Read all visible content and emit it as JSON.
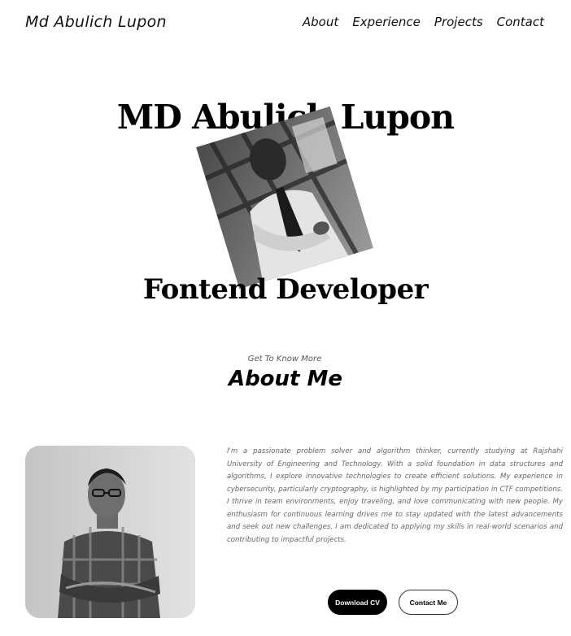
{
  "nav": {
    "logo": "Md Abulich Lupon",
    "links": [
      "About",
      "Experience",
      "Projects",
      "Contact"
    ]
  },
  "hero": {
    "name": "MD Abulich Lupon",
    "role": "Fontend Developer"
  },
  "about": {
    "subtitle": "Get To Know More",
    "title": "About Me",
    "text": "I'm a passionate problem solver and algorithm thinker, currently studying at Rajshahi University of Engineering and Technology. With a solid foundation in data structures and algorithms, I explore innovative technologies to create efficient solutions. My experience in cybersecurity, particularly cryptography, is highlighted by my participation in CTF competitions. I thrive in team environments, enjoy traveling, and love communicating with new people. My enthusiasm for continuous learning drives me to stay updated with the latest advancements and seek out new challenges. I am dedicated to applying my skills in real-world scenarios and contributing to impactful projects.",
    "buttons": {
      "cv": "Download CV",
      "contact": "Contact Me"
    }
  },
  "colors": {
    "background": "#ffffff",
    "text": "#000000",
    "muted": "#666666"
  }
}
